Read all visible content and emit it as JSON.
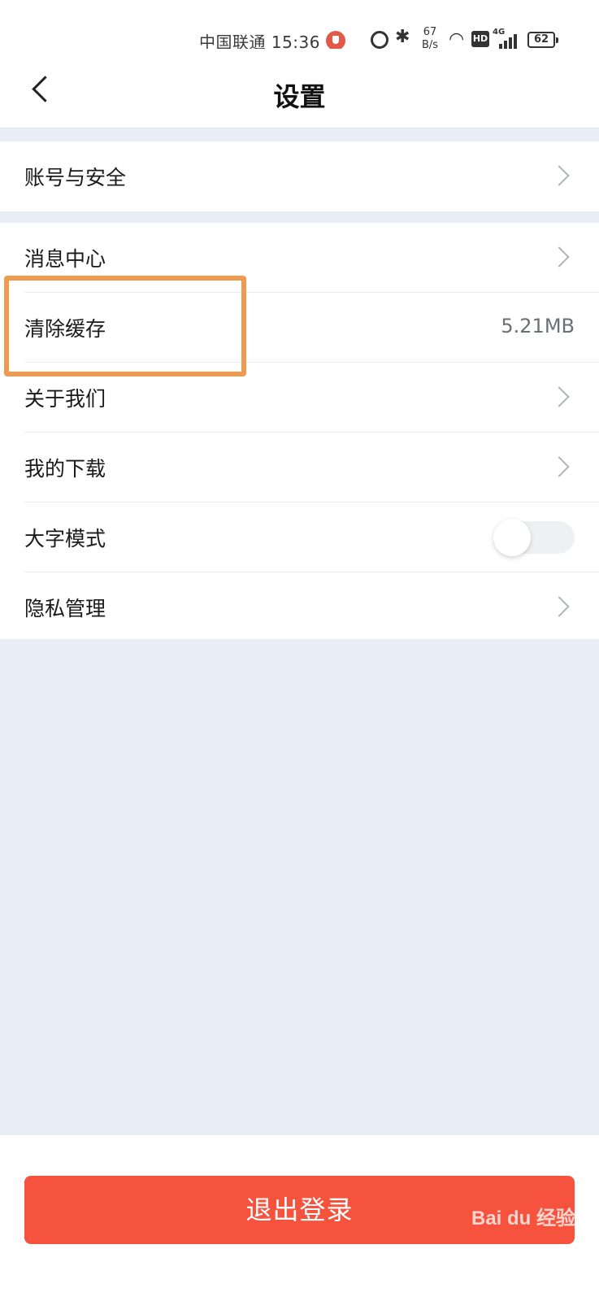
{
  "status_bar": {
    "carrier_time": "中国联通 15:36",
    "net_speed_value": "67",
    "net_speed_unit": "B/s",
    "hd": "HD",
    "network": "4G",
    "battery": "62",
    "icons": [
      "shield-icon",
      "alarm-icon",
      "bluetooth-icon",
      "wifi-icon",
      "signal-icon",
      "battery-icon"
    ]
  },
  "header": {
    "title": "设置",
    "back_icon": "chevron-left-icon"
  },
  "group1": {
    "items": [
      {
        "label": "账号与安全"
      }
    ]
  },
  "group2": {
    "items": [
      {
        "label": "消息中心"
      },
      {
        "label": "清除缓存",
        "value": "5.21MB"
      },
      {
        "label": "关于我们"
      },
      {
        "label": "我的下载"
      },
      {
        "label": "大字模式",
        "toggle_on": false
      },
      {
        "label": "隐私管理"
      }
    ]
  },
  "logout_label": "退出登录",
  "watermark": "Bai du 经验",
  "colors": {
    "accent": "#f5533d",
    "highlight": "#ef9a4f",
    "background": "#e9edf5"
  }
}
